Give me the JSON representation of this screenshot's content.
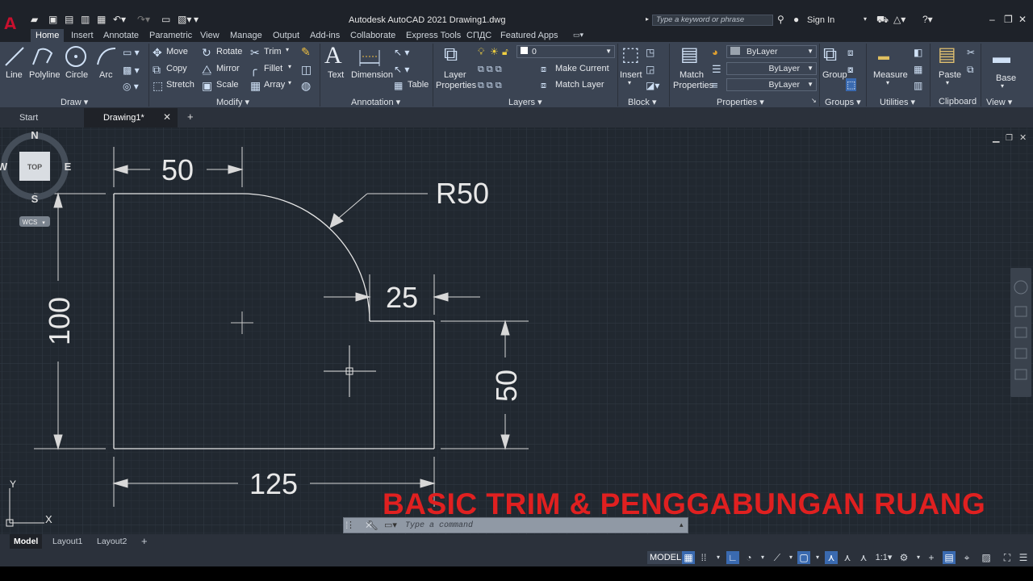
{
  "app": {
    "window_title": "Autodesk AutoCAD 2021    Drawing1.dwg",
    "search_placeholder": "Type a keyword or phrase",
    "sign_in": "Sign In"
  },
  "ribbon_tabs": [
    "Home",
    "Insert",
    "Annotate",
    "Parametric",
    "View",
    "Manage",
    "Output",
    "Add-ins",
    "Collaborate",
    "Express Tools",
    "СПДС",
    "Featured Apps"
  ],
  "ribbon": {
    "draw": {
      "title": "Draw ▾",
      "line": "Line",
      "polyline": "Polyline",
      "circle": "Circle",
      "arc": "Arc"
    },
    "modify": {
      "title": "Modify ▾",
      "move": "Move",
      "rotate": "Rotate",
      "trim": "Trim",
      "copy": "Copy",
      "mirror": "Mirror",
      "fillet": "Fillet",
      "stretch": "Stretch",
      "scale": "Scale",
      "array": "Array"
    },
    "annotation": {
      "title": "Annotation ▾",
      "text": "Text",
      "dimension": "Dimension",
      "table": "Table"
    },
    "layers": {
      "title": "Layers ▾",
      "layer_properties_1": "Layer",
      "layer_properties_2": "Properties",
      "current_layer": "0",
      "make_current": "Make Current",
      "match_layer": "Match Layer"
    },
    "block": {
      "title": "Block ▾",
      "insert": "Insert"
    },
    "properties": {
      "title": "Properties ▾",
      "match_1": "Match",
      "match_2": "Properties",
      "color": "ByLayer",
      "linetype": "ByLayer",
      "lineweight": "ByLayer"
    },
    "groups": {
      "title": "Groups ▾",
      "group": "Group"
    },
    "utilities": {
      "title": "Utilities ▾",
      "measure": "Measure"
    },
    "clipboard": {
      "title": "Clipboard",
      "paste": "Paste"
    },
    "view": {
      "title": "View ▾",
      "base": "Base"
    }
  },
  "file_tabs": {
    "start": "Start",
    "drawing": "Drawing1*"
  },
  "drawing": {
    "dim_top": "50",
    "dim_radius": "R50",
    "dim_notch": "25",
    "dim_left": "100",
    "dim_right": "50",
    "dim_bottom": "125"
  },
  "viewcube": {
    "n": "N",
    "s": "S",
    "e": "E",
    "w": "W",
    "face": "TOP",
    "wcs": "WCS"
  },
  "ucs": {
    "x": "X",
    "y": "Y"
  },
  "command_line": {
    "placeholder": "Type a command"
  },
  "banner": "BASIC TRIM & PENGGABUNGAN RUANG",
  "layout_tabs": [
    "Model",
    "Layout1",
    "Layout2"
  ],
  "status": {
    "model": "MODEL",
    "scale": "1:1"
  },
  "colors": {
    "accent": "#3a6ab0",
    "banner": "#e02020",
    "canvas": "#212830",
    "ribbon": "#3b4453"
  }
}
